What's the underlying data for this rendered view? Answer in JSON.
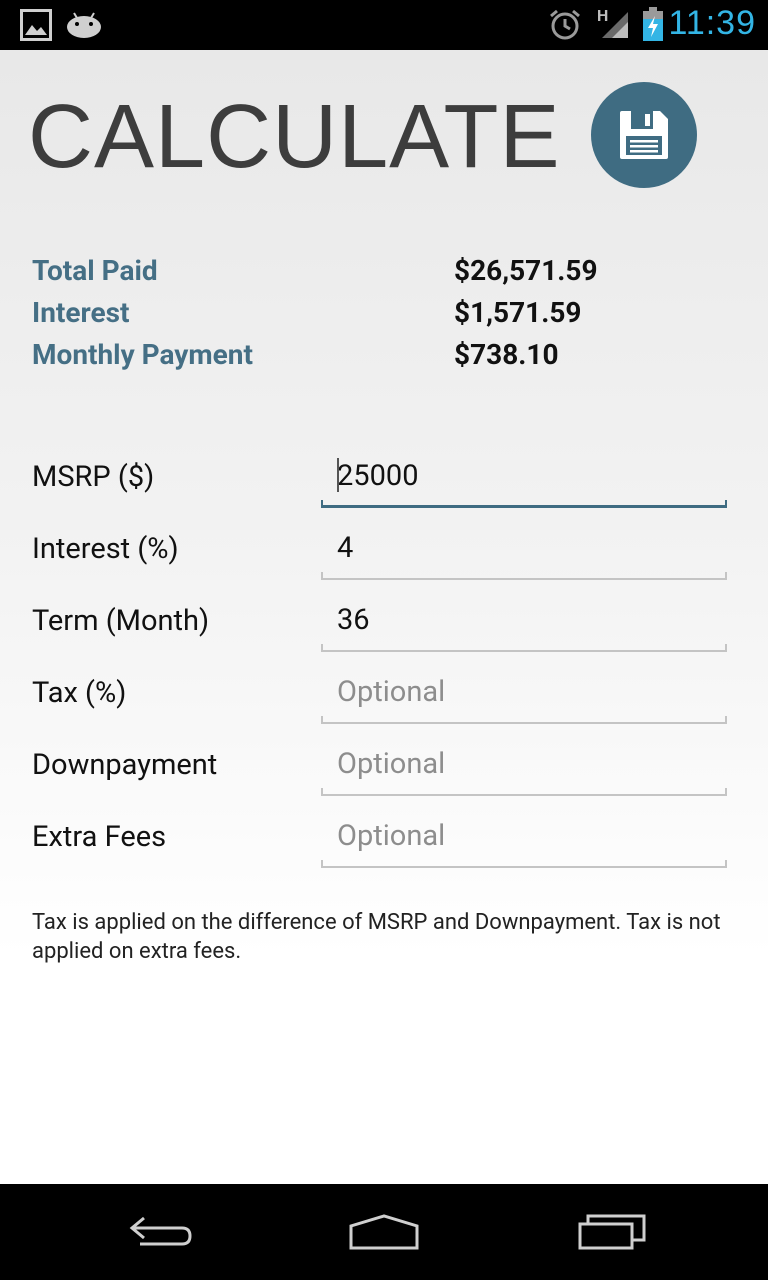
{
  "status_bar": {
    "time": "11:39",
    "network_label": "H",
    "icons": [
      "picture-icon",
      "android-icon",
      "alarm-icon",
      "signal-icon",
      "battery-charging-icon"
    ]
  },
  "header": {
    "title": "CALCULATE",
    "save_icon": "floppy-disk-icon",
    "accent_color": "#3f6c82"
  },
  "summary": [
    {
      "label": "Total Paid",
      "value": "$26,571.59"
    },
    {
      "label": "Interest",
      "value": "$1,571.59"
    },
    {
      "label": "Monthly Payment",
      "value": "$738.10"
    }
  ],
  "form": [
    {
      "label": "MSRP ($)",
      "value": "25000",
      "placeholder": ""
    },
    {
      "label": "Interest (%)",
      "value": "4",
      "placeholder": ""
    },
    {
      "label": "Term (Month)",
      "value": "36",
      "placeholder": ""
    },
    {
      "label": "Tax (%)",
      "value": "",
      "placeholder": "Optional"
    },
    {
      "label": "Downpayment",
      "value": "",
      "placeholder": "Optional"
    },
    {
      "label": "Extra Fees",
      "value": "",
      "placeholder": "Optional"
    }
  ],
  "note": "Tax is applied on the difference of MSRP and Downpayment. Tax is not applied on extra fees.",
  "nav_bar": {
    "icons": [
      "back-icon",
      "home-icon",
      "recent-apps-icon"
    ]
  }
}
